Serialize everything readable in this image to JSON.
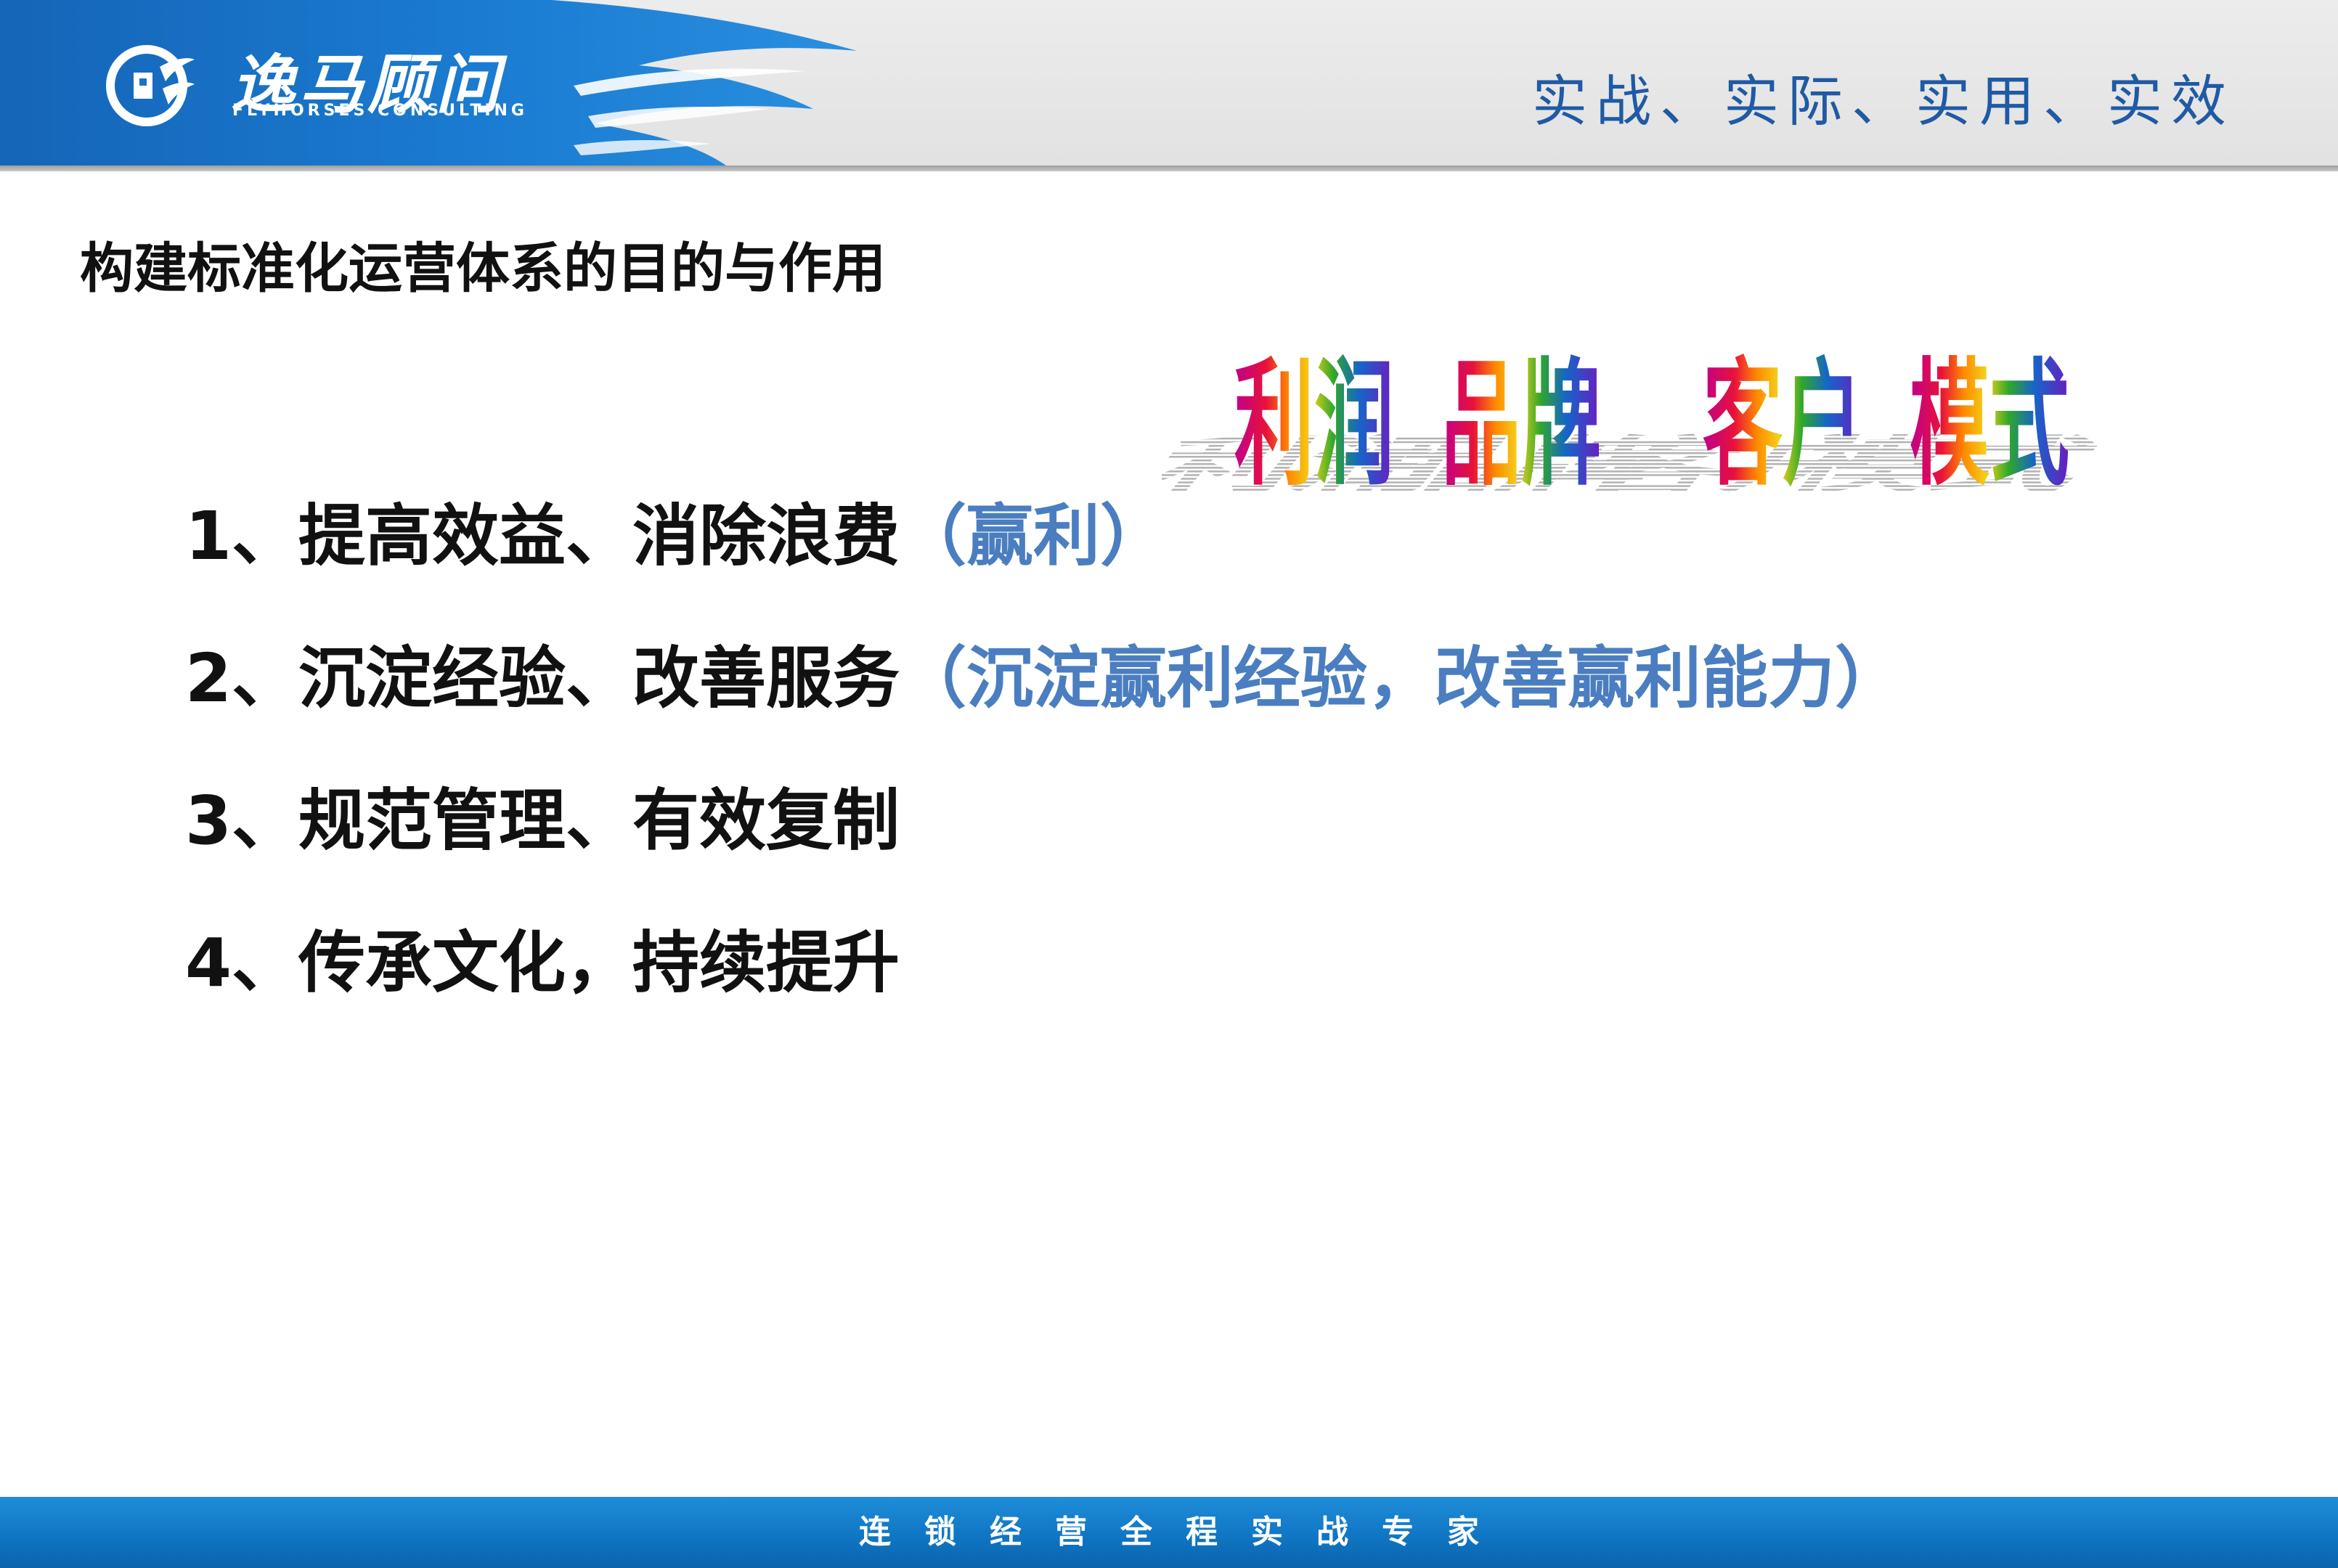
{
  "header": {
    "brand_name": "逸马顾问",
    "brand_sub": "FLYHORSES CONSULTING",
    "slogan": "实战、实际、实用、实效",
    "colors": {
      "blue": "#1a73c7",
      "slogan": "#1f5aa4"
    }
  },
  "title": "构建标准化运营体系的目的与作用",
  "wordart": {
    "words": [
      "利润",
      "品牌",
      "客户",
      "模式"
    ]
  },
  "points": [
    {
      "main": "1、提高效益、消除浪费",
      "note": "（赢利）"
    },
    {
      "main": "2、沉淀经验、改善服务",
      "note": "（沉淀赢利经验，改善赢利能力）"
    },
    {
      "main": "3、规范管理、有效复制",
      "note": ""
    },
    {
      "main": "4、传承文化，持续提升",
      "note": ""
    }
  ],
  "footer": {
    "text": "连锁经营全程实战专家",
    "color": "#1076c4"
  }
}
